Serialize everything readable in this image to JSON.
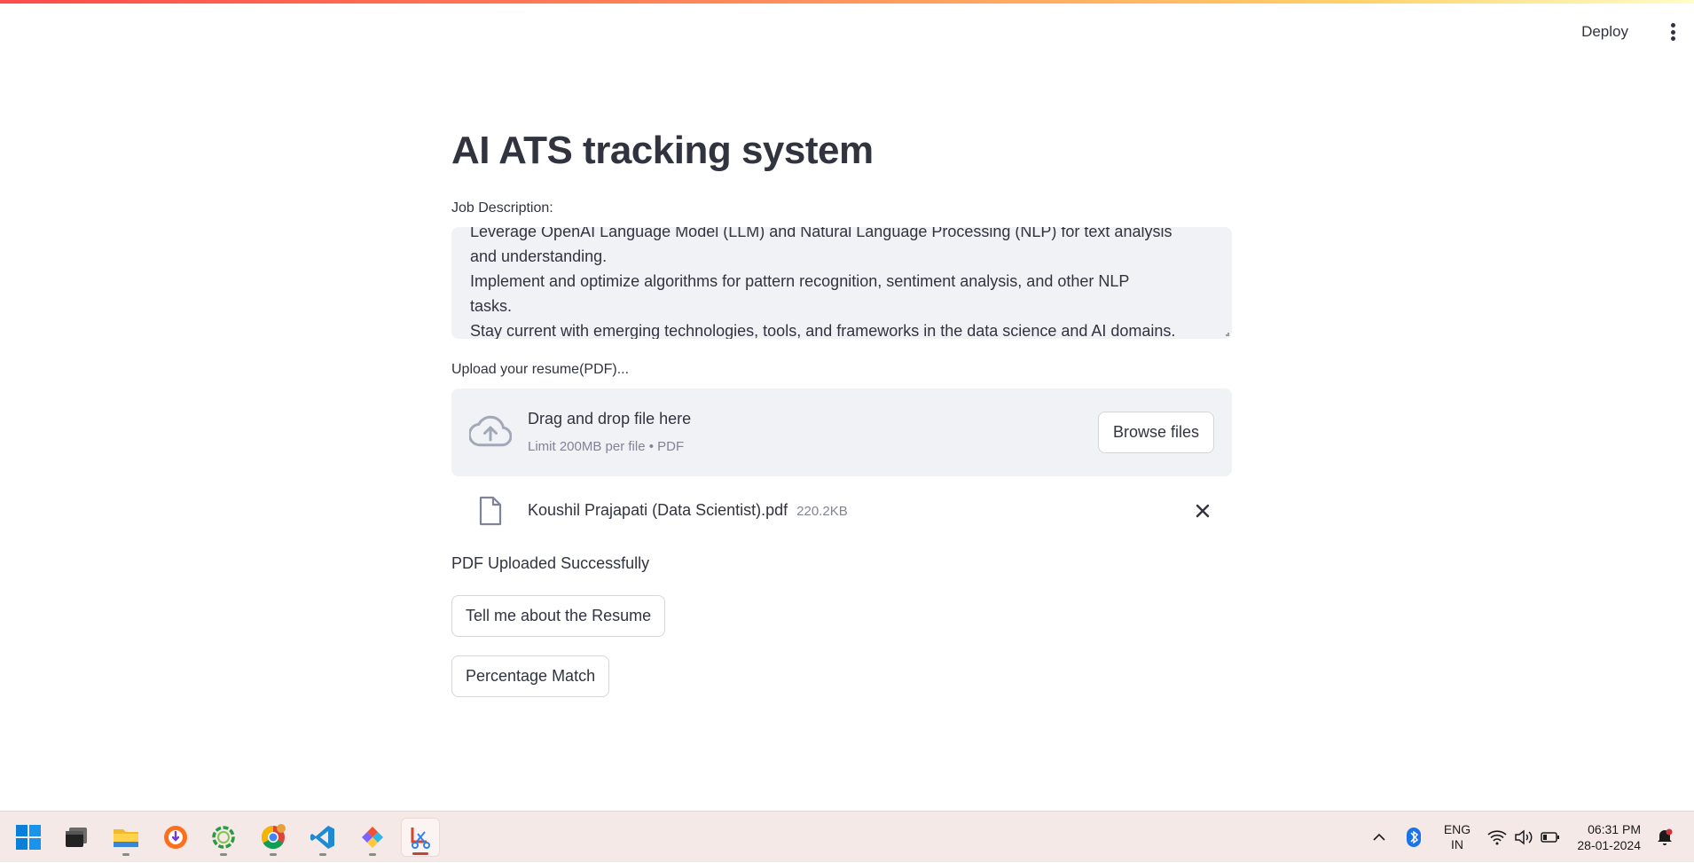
{
  "header": {
    "deploy_label": "Deploy",
    "menu_icon": "vertical-ellipsis-icon"
  },
  "page": {
    "title": "AI ATS tracking system"
  },
  "job_description": {
    "label": "Job Description:",
    "value": "Leverage OpenAI Language Model (LLM) and Natural Language Processing (NLP) for text analysis\nand understanding.\nImplement and optimize algorithms for pattern recognition, sentiment analysis, and other NLP\ntasks.\nStay current with emerging technologies, tools, and frameworks in the data science and AI domains."
  },
  "uploader": {
    "label": "Upload your resume(PDF)...",
    "drop_title": "Drag and drop file here",
    "drop_subtitle": "Limit 200MB per file • PDF",
    "browse_label": "Browse files",
    "uploaded_file": {
      "name": "Koushil Prajapati (Data Scientist).pdf",
      "size": "220.2KB"
    }
  },
  "status": {
    "message": "PDF Uploaded Successfully"
  },
  "actions": {
    "tell_me_label": "Tell me about the Resume",
    "percentage_match_label": "Percentage Match"
  },
  "taskbar": {
    "apps": [
      {
        "name": "start-icon"
      },
      {
        "name": "task-view-icon"
      },
      {
        "name": "file-explorer-icon"
      },
      {
        "name": "brave-browser-icon"
      },
      {
        "name": "sync-app-icon"
      },
      {
        "name": "chrome-icon"
      },
      {
        "name": "vscode-icon"
      },
      {
        "name": "git-icon"
      },
      {
        "name": "snipping-tool-icon"
      }
    ],
    "language": {
      "line1": "ENG",
      "line2": "IN"
    },
    "clock": {
      "time": "06:31 PM",
      "date": "28-01-2024"
    }
  },
  "colors": {
    "accent": "#ff4b4b",
    "input_background": "#f0f2f6",
    "muted_text": "#808495",
    "taskbar_background": "#f4e9e6"
  }
}
